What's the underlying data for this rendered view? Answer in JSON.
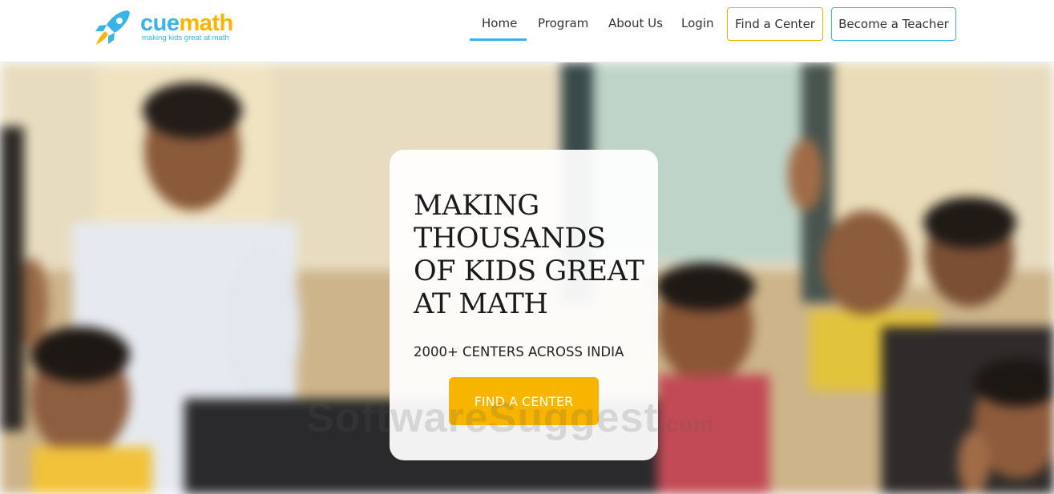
{
  "brand": {
    "name_part1": "cue",
    "name_part2": "math",
    "tagline": "making kids great at math",
    "colors": {
      "blue": "#3ab4e8",
      "yellow": "#f7b500"
    },
    "icon": "rocket-icon"
  },
  "nav": {
    "items": [
      {
        "label": "Home",
        "active": true
      },
      {
        "label": "Program",
        "active": false
      },
      {
        "label": "About Us",
        "active": false
      },
      {
        "label": "Login",
        "active": false
      }
    ],
    "find_center_button": "Find a Center",
    "become_teacher_button": "Become a Teacher"
  },
  "hero": {
    "headline_lines": [
      "MAKING",
      "THOUSANDS",
      "OF KIDS GREAT",
      "AT MATH"
    ],
    "subline": "2000+ CENTERS ACROSS INDIA",
    "cta_label": "FIND A CENTER",
    "watermark_main": "SoftwareSuggest",
    "watermark_suffix": ".com"
  }
}
